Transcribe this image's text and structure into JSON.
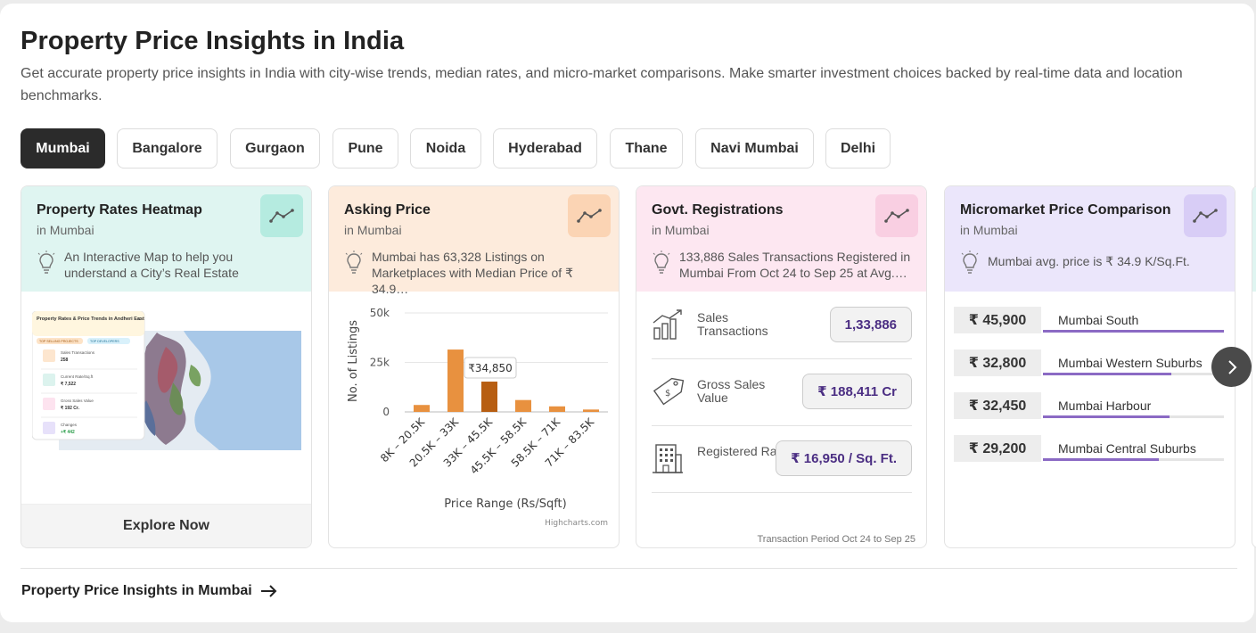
{
  "header": {
    "title": "Property Price Insights in India",
    "subtitle": "Get accurate property price insights in India with city-wise trends, median rates, and micro-market comparisons. Make smarter investment choices backed by real-time data and location benchmarks."
  },
  "city_tabs": [
    {
      "label": "Mumbai",
      "active": true
    },
    {
      "label": "Bangalore"
    },
    {
      "label": "Gurgaon"
    },
    {
      "label": "Pune"
    },
    {
      "label": "Noida"
    },
    {
      "label": "Hyderabad"
    },
    {
      "label": "Thane"
    },
    {
      "label": "Navi Mumbai"
    },
    {
      "label": "Delhi"
    }
  ],
  "cards": {
    "heatmap": {
      "title": "Property Rates Heatmap",
      "subtitle": "in Mumbai",
      "note": "An Interactive Map to help you understand a City’s Real Estate",
      "cta": "Explore Now",
      "accent": "#dff5f1",
      "thumb": {
        "heading": "Property Rates & Price Trends in Andheri East",
        "chip1": "TOP SELLING PROJECTS",
        "chip2": "TOP DEVELOPERS",
        "items": [
          {
            "label": "Sales Transactions",
            "value": "258"
          },
          {
            "label": "Current Rate/Sq.ft",
            "value": "₹ 7,522"
          },
          {
            "label": "Gross Sales Value",
            "value": "₹ 192 Cr."
          },
          {
            "label": "Changes",
            "value": "+₹ 442"
          }
        ]
      }
    },
    "asking": {
      "title": "Asking Price",
      "subtitle": "in Mumbai",
      "note": "Mumbai has 63,328 Listings on Marketplaces with Median Price of ₹ 34.9…",
      "accent": "#fdebdc",
      "credit": "Highcharts.com"
    },
    "govt": {
      "title": "Govt. Registrations",
      "subtitle": "in Mumbai",
      "note": "133,886 Sales Transactions Registered in Mumbai From Oct 24 to Sep 25 at Avg.…",
      "accent": "#fde7f1",
      "rows": [
        {
          "label": "Sales Transactions",
          "value": "1,33,886",
          "icon": "bar-growth-icon"
        },
        {
          "label": "Gross Sales Value",
          "value": "₹ 188,411 Cr",
          "icon": "price-tag-icon"
        },
        {
          "label": "Registered Rate",
          "value": "₹ 16,950 / Sq. Ft.",
          "icon": "building-icon"
        }
      ],
      "period": "Transaction Period Oct 24 to Sep 25"
    },
    "micromarket": {
      "title": "Micromarket Price Comparison",
      "subtitle": "in Mumbai",
      "note": "Mumbai avg. price is ₹ 34.9 K/Sq.Ft.",
      "accent": "#ebe6fb",
      "rows": [
        {
          "price": "₹ 45,900",
          "name": "Mumbai South",
          "level": 1.0
        },
        {
          "price": "₹ 32,800",
          "name": "Mumbai Western Suburbs",
          "level": 0.71
        },
        {
          "price": "₹ 32,450",
          "name": "Mumbai Harbour",
          "level": 0.7
        },
        {
          "price": "₹ 29,200",
          "name": "Mumbai Central Suburbs",
          "level": 0.64
        }
      ]
    }
  },
  "chart_data": {
    "type": "bar",
    "categories": [
      "8K – 20.5K",
      "20.5K – 33K",
      "33K – 45.5K",
      "45.5K – 58.5K",
      "58.5K – 71K",
      "71K – 83.5K"
    ],
    "values": [
      3500,
      31500,
      15300,
      6000,
      2800,
      1200
    ],
    "highlight_index": 2,
    "tooltip": "₹34,850",
    "xlabel": "Price Range (Rs/Sqft)",
    "ylabel": "No. of Listings",
    "yticks": [
      "0",
      "25k",
      "50k"
    ],
    "ylim": [
      0,
      50000
    ],
    "colors": {
      "bar": "#e8913f",
      "highlight": "#b75e12"
    }
  },
  "footer": {
    "link": "Property Price Insights in Mumbai"
  }
}
